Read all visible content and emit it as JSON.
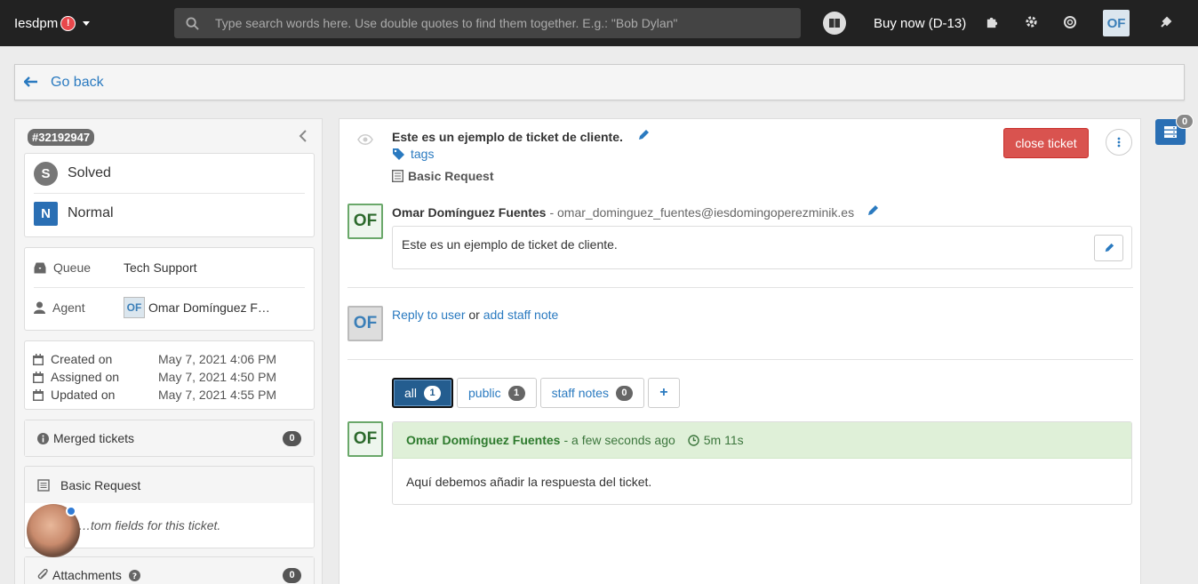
{
  "topbar": {
    "brand": "Iesdpm",
    "alert": "!",
    "search_placeholder": "Type search words here. Use double quotes to find them together. E.g.: \"Bob Dylan\"",
    "buy_now": "Buy now (D-13)",
    "user_initials": "OF",
    "icons": [
      "search-icon",
      "book-icon",
      "puzzle-icon",
      "gear-icon",
      "lifebuoy-icon",
      "plug-icon"
    ]
  },
  "goback": {
    "label": "Go back"
  },
  "ticket": {
    "id": "#32192947",
    "status": {
      "letter": "S",
      "label": "Solved"
    },
    "priority": {
      "letter": "N",
      "label": "Normal"
    },
    "queue": {
      "label": "Queue",
      "value": "Tech Support"
    },
    "agent": {
      "label": "Agent",
      "initials": "OF",
      "value": "Omar Domínguez F…"
    },
    "dates": [
      {
        "label": "Created on",
        "value": "May 7, 2021 4:06 PM"
      },
      {
        "label": "Assigned on",
        "value": "May 7, 2021 4:50 PM"
      },
      {
        "label": "Updated on",
        "value": "May 7, 2021 4:55 PM"
      }
    ],
    "merged": {
      "label": "Merged tickets",
      "count": "0"
    },
    "form": {
      "label": "Basic Request",
      "custom_fields_text": "…tom fields for this ticket."
    },
    "attachments": {
      "label": "Attachments",
      "count": "0"
    }
  },
  "main": {
    "title": "Este es un ejemplo de ticket de cliente.",
    "tags_label": "tags",
    "form_label": "Basic Request",
    "close_label": "close ticket",
    "message": {
      "initials": "OF",
      "author": "Omar Domínguez Fuentes",
      "email": "- omar_dominguez_fuentes@iesdomingoperezminik.es",
      "body": "Este es un ejemplo de ticket de cliente."
    },
    "reply_initials": "OF",
    "reply_link": "Reply to user",
    "reply_or": "or",
    "staff_note_link": "add staff note",
    "filters": [
      {
        "label": "all",
        "count": "1"
      },
      {
        "label": "public",
        "count": "1"
      },
      {
        "label": "staff notes",
        "count": "0"
      }
    ],
    "add_label": "+",
    "reply_card": {
      "initials": "OF",
      "author": "Omar Domínguez Fuentes",
      "time": "- a few seconds ago",
      "duration": "5m 11s",
      "body": "Aquí debemos añadir la respuesta del ticket."
    }
  },
  "notifications": {
    "count": "0"
  },
  "colors": {
    "accent": "#2a7ac0",
    "danger": "#d9534f",
    "success_bg": "#dff0d8",
    "topbar": "#222222"
  }
}
